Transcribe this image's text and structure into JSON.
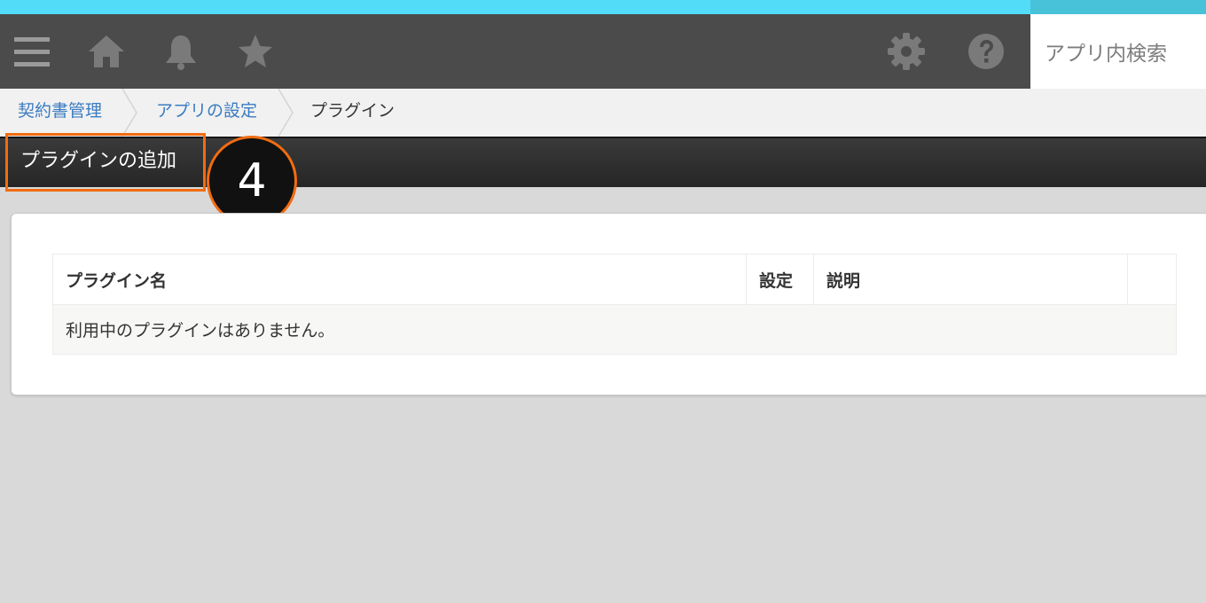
{
  "header": {
    "icons": {
      "menu": "menu-icon",
      "home": "home-icon",
      "notifications": "bell-icon",
      "favorites": "star-icon",
      "settings": "gear-icon",
      "help": "help-icon"
    },
    "search": {
      "placeholder": "アプリ内検索"
    }
  },
  "breadcrumb": {
    "items": [
      {
        "label": "契約書管理"
      },
      {
        "label": "アプリの設定"
      },
      {
        "label": "プラグイン"
      }
    ]
  },
  "toolbar": {
    "add_plugin_label": "プラグインの追加"
  },
  "annotation": {
    "step_number": "4"
  },
  "plugins_table": {
    "columns": [
      "プラグイン名",
      "設定",
      "説明",
      ""
    ],
    "empty_message": "利用中のプラグインはありません。"
  },
  "colors": {
    "accent_strip": "#52dcf8",
    "header_bg": "#4b4b4b",
    "highlight": "#f26c11",
    "link": "#3a7cc2"
  }
}
